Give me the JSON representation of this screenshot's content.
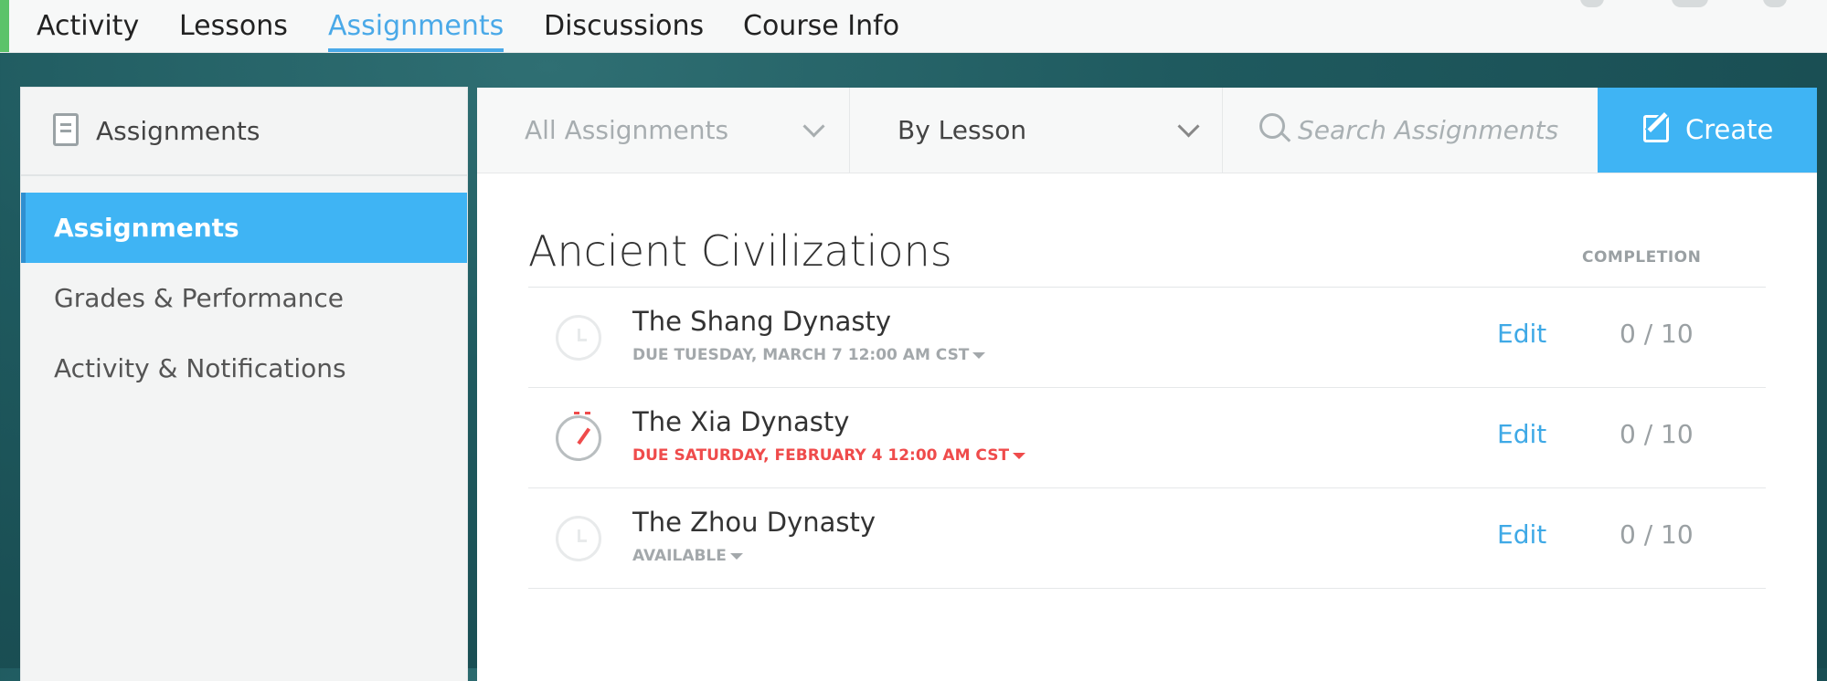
{
  "topnav": {
    "items": [
      {
        "label": "Activity",
        "active": false
      },
      {
        "label": "Lessons",
        "active": false
      },
      {
        "label": "Assignments",
        "active": true
      },
      {
        "label": "Discussions",
        "active": false
      },
      {
        "label": "Course Info",
        "active": false
      }
    ],
    "accent_color": "#4aa9e8"
  },
  "sidebar": {
    "title": "Assignments",
    "items": [
      {
        "label": "Assignments",
        "active": true
      },
      {
        "label": "Grades & Performance",
        "active": false
      },
      {
        "label": "Activity & Notifications",
        "active": false
      }
    ]
  },
  "toolbar": {
    "filter_label": "All Assignments",
    "group_label": "By Lesson",
    "search_placeholder": "Search Assignments",
    "create_label": "Create"
  },
  "section": {
    "title": "Ancient Civilizations",
    "completion_header": "COMPLETION"
  },
  "assignments": [
    {
      "title": "The Shang Dynasty",
      "status": "DUE TUESDAY, MARCH 7 12:00 AM CST",
      "overdue": false,
      "edit_label": "Edit",
      "score": "0 / 10"
    },
    {
      "title": "The Xia Dynasty",
      "status": "DUE SATURDAY, FEBRUARY 4 12:00 AM CST",
      "overdue": true,
      "edit_label": "Edit",
      "score": "0 / 10"
    },
    {
      "title": "The Zhou Dynasty",
      "status": "AVAILABLE",
      "overdue": false,
      "edit_label": "Edit",
      "score": "0 / 10"
    }
  ],
  "colors": {
    "brand_blue": "#3fb4f4",
    "link_blue": "#3fa9e6",
    "overdue_red": "#ef4b4b",
    "background_teal": "#1f5a5f"
  }
}
